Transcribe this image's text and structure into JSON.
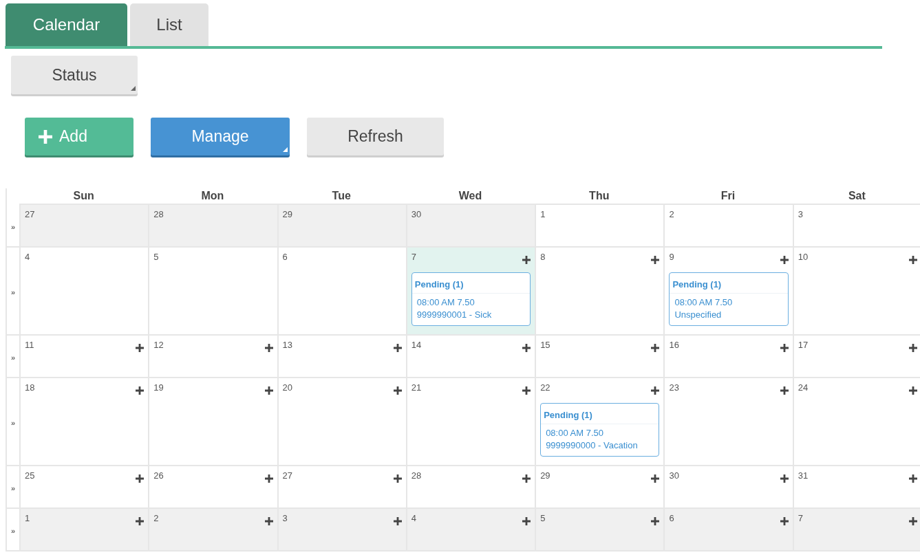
{
  "tabs": [
    {
      "label": "Calendar",
      "selected": true
    },
    {
      "label": "List",
      "selected": false
    }
  ],
  "status_button": {
    "label": "Status",
    "dropdown": true
  },
  "toolbar": [
    {
      "kind": "add",
      "label": "Add",
      "dropdown": false
    },
    {
      "kind": "manage",
      "label": "Manage",
      "dropdown": true
    },
    {
      "kind": "refresh",
      "label": "Refresh",
      "dropdown": false
    }
  ],
  "calendar": {
    "weekdays": [
      "Sun",
      "Mon",
      "Tue",
      "Wed",
      "Thu",
      "Fri",
      "Sat"
    ],
    "weeks": [
      {
        "handle": "»",
        "days": [
          {
            "day": "27",
            "other_month": true,
            "today": false,
            "can_add": false
          },
          {
            "day": "28",
            "other_month": true,
            "today": false,
            "can_add": false
          },
          {
            "day": "29",
            "other_month": true,
            "today": false,
            "can_add": false
          },
          {
            "day": "30",
            "other_month": true,
            "today": false,
            "can_add": false
          },
          {
            "day": "1",
            "other_month": false,
            "today": false,
            "can_add": false
          },
          {
            "day": "2",
            "other_month": false,
            "today": false,
            "can_add": false
          },
          {
            "day": "3",
            "other_month": false,
            "today": false,
            "can_add": false
          }
        ]
      },
      {
        "handle": "»",
        "days": [
          {
            "day": "4",
            "other_month": false,
            "today": false,
            "can_add": false
          },
          {
            "day": "5",
            "other_month": false,
            "today": false,
            "can_add": false
          },
          {
            "day": "6",
            "other_month": false,
            "today": false,
            "can_add": false
          },
          {
            "day": "7",
            "other_month": false,
            "today": true,
            "can_add": true,
            "events": [
              {
                "title": "Pending (1)",
                "lines": [
                  "08:00 AM 7.50",
                  "9999990001 - Sick"
                ]
              }
            ]
          },
          {
            "day": "8",
            "other_month": false,
            "today": false,
            "can_add": true
          },
          {
            "day": "9",
            "other_month": false,
            "today": false,
            "can_add": true,
            "events": [
              {
                "title": "Pending (1)",
                "lines": [
                  "08:00 AM 7.50",
                  "Unspecified"
                ]
              }
            ]
          },
          {
            "day": "10",
            "other_month": false,
            "today": false,
            "can_add": true
          }
        ]
      },
      {
        "handle": "»",
        "days": [
          {
            "day": "11",
            "other_month": false,
            "today": false,
            "can_add": true
          },
          {
            "day": "12",
            "other_month": false,
            "today": false,
            "can_add": true
          },
          {
            "day": "13",
            "other_month": false,
            "today": false,
            "can_add": true
          },
          {
            "day": "14",
            "other_month": false,
            "today": false,
            "can_add": true
          },
          {
            "day": "15",
            "other_month": false,
            "today": false,
            "can_add": true
          },
          {
            "day": "16",
            "other_month": false,
            "today": false,
            "can_add": true
          },
          {
            "day": "17",
            "other_month": false,
            "today": false,
            "can_add": true
          }
        ]
      },
      {
        "handle": "»",
        "days": [
          {
            "day": "18",
            "other_month": false,
            "today": false,
            "can_add": true
          },
          {
            "day": "19",
            "other_month": false,
            "today": false,
            "can_add": true
          },
          {
            "day": "20",
            "other_month": false,
            "today": false,
            "can_add": true
          },
          {
            "day": "21",
            "other_month": false,
            "today": false,
            "can_add": true
          },
          {
            "day": "22",
            "other_month": false,
            "today": false,
            "can_add": true,
            "events": [
              {
                "title": "Pending (1)",
                "lines": [
                  "08:00 AM 7.50",
                  "9999990000 - Vacation"
                ]
              }
            ]
          },
          {
            "day": "23",
            "other_month": false,
            "today": false,
            "can_add": true
          },
          {
            "day": "24",
            "other_month": false,
            "today": false,
            "can_add": true
          }
        ]
      },
      {
        "handle": "»",
        "days": [
          {
            "day": "25",
            "other_month": false,
            "today": false,
            "can_add": true
          },
          {
            "day": "26",
            "other_month": false,
            "today": false,
            "can_add": true
          },
          {
            "day": "27",
            "other_month": false,
            "today": false,
            "can_add": true
          },
          {
            "day": "28",
            "other_month": false,
            "today": false,
            "can_add": true
          },
          {
            "day": "29",
            "other_month": false,
            "today": false,
            "can_add": true
          },
          {
            "day": "30",
            "other_month": false,
            "today": false,
            "can_add": true
          },
          {
            "day": "31",
            "other_month": false,
            "today": false,
            "can_add": true
          }
        ]
      },
      {
        "handle": "»",
        "days": [
          {
            "day": "1",
            "other_month": true,
            "today": false,
            "can_add": true
          },
          {
            "day": "2",
            "other_month": true,
            "today": false,
            "can_add": true
          },
          {
            "day": "3",
            "other_month": true,
            "today": false,
            "can_add": true
          },
          {
            "day": "4",
            "other_month": true,
            "today": false,
            "can_add": true
          },
          {
            "day": "5",
            "other_month": true,
            "today": false,
            "can_add": true
          },
          {
            "day": "6",
            "other_month": true,
            "today": false,
            "can_add": true
          },
          {
            "day": "7",
            "other_month": true,
            "today": false,
            "can_add": true
          }
        ]
      }
    ]
  }
}
